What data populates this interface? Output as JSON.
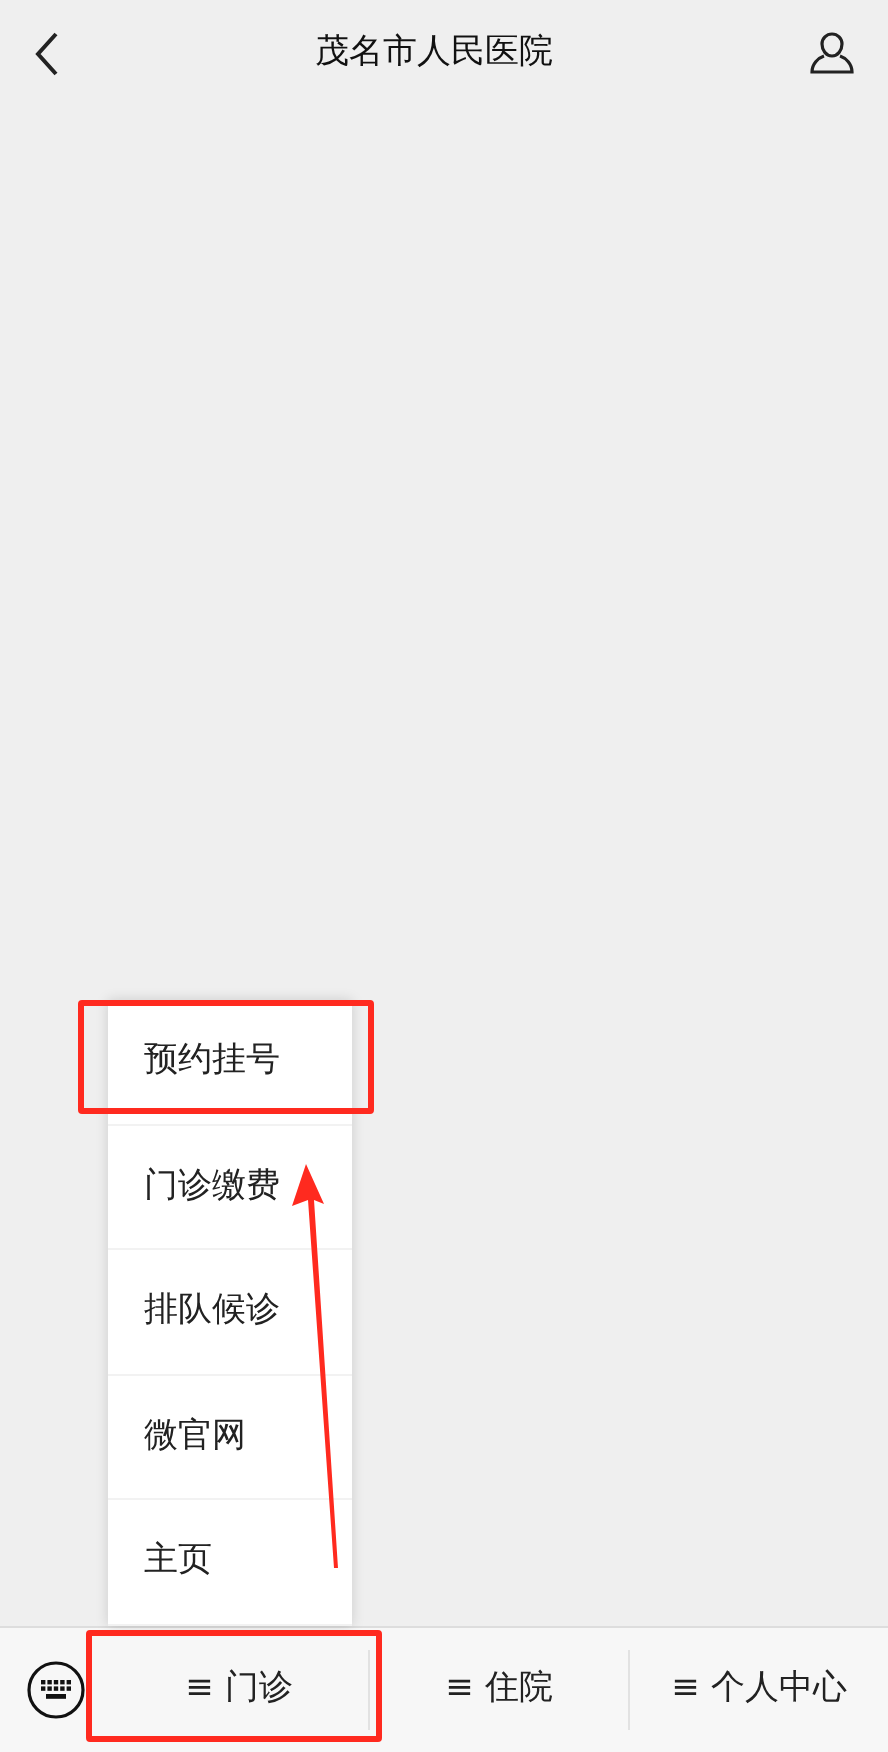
{
  "header": {
    "title": "茂名市人民医院"
  },
  "bottom_menu": [
    {
      "label": "≡ 门诊",
      "submenu": [
        "预约挂号",
        "门诊缴费",
        "排队候诊",
        "微官网",
        "主页"
      ]
    },
    {
      "label": "≡ 住院"
    },
    {
      "label": "≡ 个人中心"
    }
  ]
}
